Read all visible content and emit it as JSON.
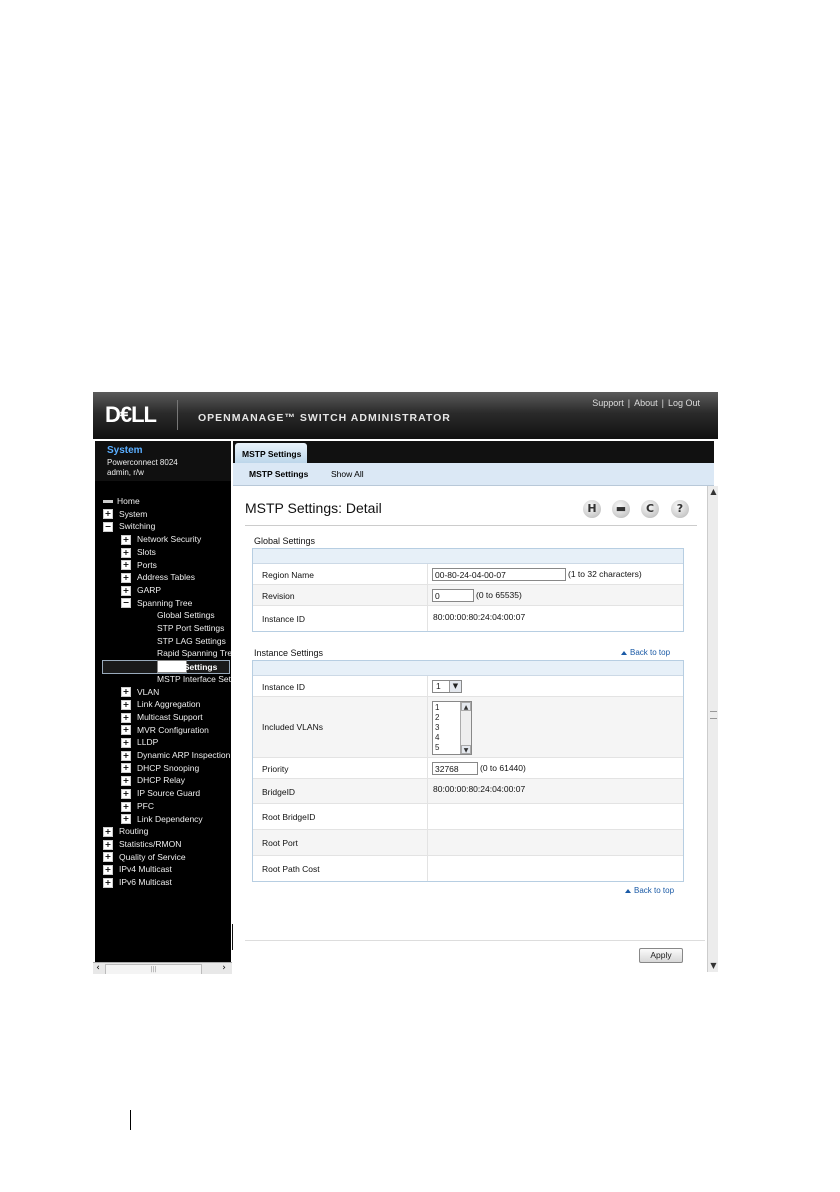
{
  "header": {
    "logo": "D€LL",
    "product": "OPENMANAGE™ SWITCH ADMINISTRATOR",
    "links": [
      "Support",
      "About",
      "Log Out"
    ],
    "sep": "|"
  },
  "system": {
    "title": "System",
    "model": "Powerconnect 8024",
    "user": "admin, r/w"
  },
  "tree": [
    {
      "label": "Home",
      "icon": "home"
    },
    {
      "label": "System",
      "icon": "plus"
    },
    {
      "label": "Switching",
      "icon": "minus"
    },
    {
      "label": "Network Security",
      "icon": "plus"
    },
    {
      "label": "Slots",
      "icon": "plus"
    },
    {
      "label": "Ports",
      "icon": "plus"
    },
    {
      "label": "Address Tables",
      "icon": "plus"
    },
    {
      "label": "GARP",
      "icon": "plus"
    },
    {
      "label": "Spanning Tree",
      "icon": "minus"
    },
    {
      "label": "Global Settings",
      "icon": "none"
    },
    {
      "label": "STP Port Settings",
      "icon": "none"
    },
    {
      "label": "STP LAG Settings",
      "icon": "none"
    },
    {
      "label": "Rapid Spanning Tre",
      "icon": "none"
    },
    {
      "label": "MSTP Settings",
      "icon": "none"
    },
    {
      "label": "MSTP Interface Sett",
      "icon": "none"
    },
    {
      "label": "VLAN",
      "icon": "plus"
    },
    {
      "label": "Link Aggregation",
      "icon": "plus"
    },
    {
      "label": "Multicast Support",
      "icon": "plus"
    },
    {
      "label": "MVR Configuration",
      "icon": "plus"
    },
    {
      "label": "LLDP",
      "icon": "plus"
    },
    {
      "label": "Dynamic ARP Inspection",
      "icon": "plus"
    },
    {
      "label": "DHCP Snooping",
      "icon": "plus"
    },
    {
      "label": "DHCP Relay",
      "icon": "plus"
    },
    {
      "label": "IP Source Guard",
      "icon": "plus"
    },
    {
      "label": "PFC",
      "icon": "plus"
    },
    {
      "label": "Link Dependency",
      "icon": "plus"
    },
    {
      "label": "Routing",
      "icon": "plus"
    },
    {
      "label": "Statistics/RMON",
      "icon": "plus"
    },
    {
      "label": "Quality of Service",
      "icon": "plus"
    },
    {
      "label": "IPv4 Multicast",
      "icon": "plus"
    },
    {
      "label": "IPv6 Multicast",
      "icon": "plus"
    }
  ],
  "tabs": {
    "main": "MSTP Settings",
    "sub": [
      "MSTP Settings",
      "Show All"
    ]
  },
  "page": {
    "title": "MSTP Settings: Detail",
    "toolbar_icons": [
      "save-icon",
      "print-icon",
      "refresh-icon",
      "help-icon"
    ]
  },
  "global_settings": {
    "title": "Global Settings",
    "region_name_label": "Region Name",
    "region_name_value": "00-80-24-04-00-07",
    "region_name_hint": "(1 to 32 characters)",
    "revision_label": "Revision",
    "revision_value": "0",
    "revision_hint": "(0 to 65535)",
    "instance_id_label": "Instance ID",
    "instance_id_value": "80:00:00:80:24:04:00:07"
  },
  "instance_settings": {
    "title": "Instance Settings",
    "back_to_top": "Back to top",
    "instance_id_label": "Instance ID",
    "instance_id_selected": "1",
    "included_vlans_label": "Included VLANs",
    "vlan_options": [
      "1",
      "2",
      "3",
      "4",
      "5"
    ],
    "priority_label": "Priority",
    "priority_value": "32768",
    "priority_hint": "(0 to 61440)",
    "bridge_id_label": "BridgeID",
    "bridge_id_value": "80:00:00:80:24:04:00:07",
    "root_bridge_id_label": "Root BridgeID",
    "root_port_label": "Root Port",
    "root_path_cost_label": "Root Path Cost"
  },
  "footer": {
    "back_to_top": "Back to top",
    "apply": "Apply"
  }
}
